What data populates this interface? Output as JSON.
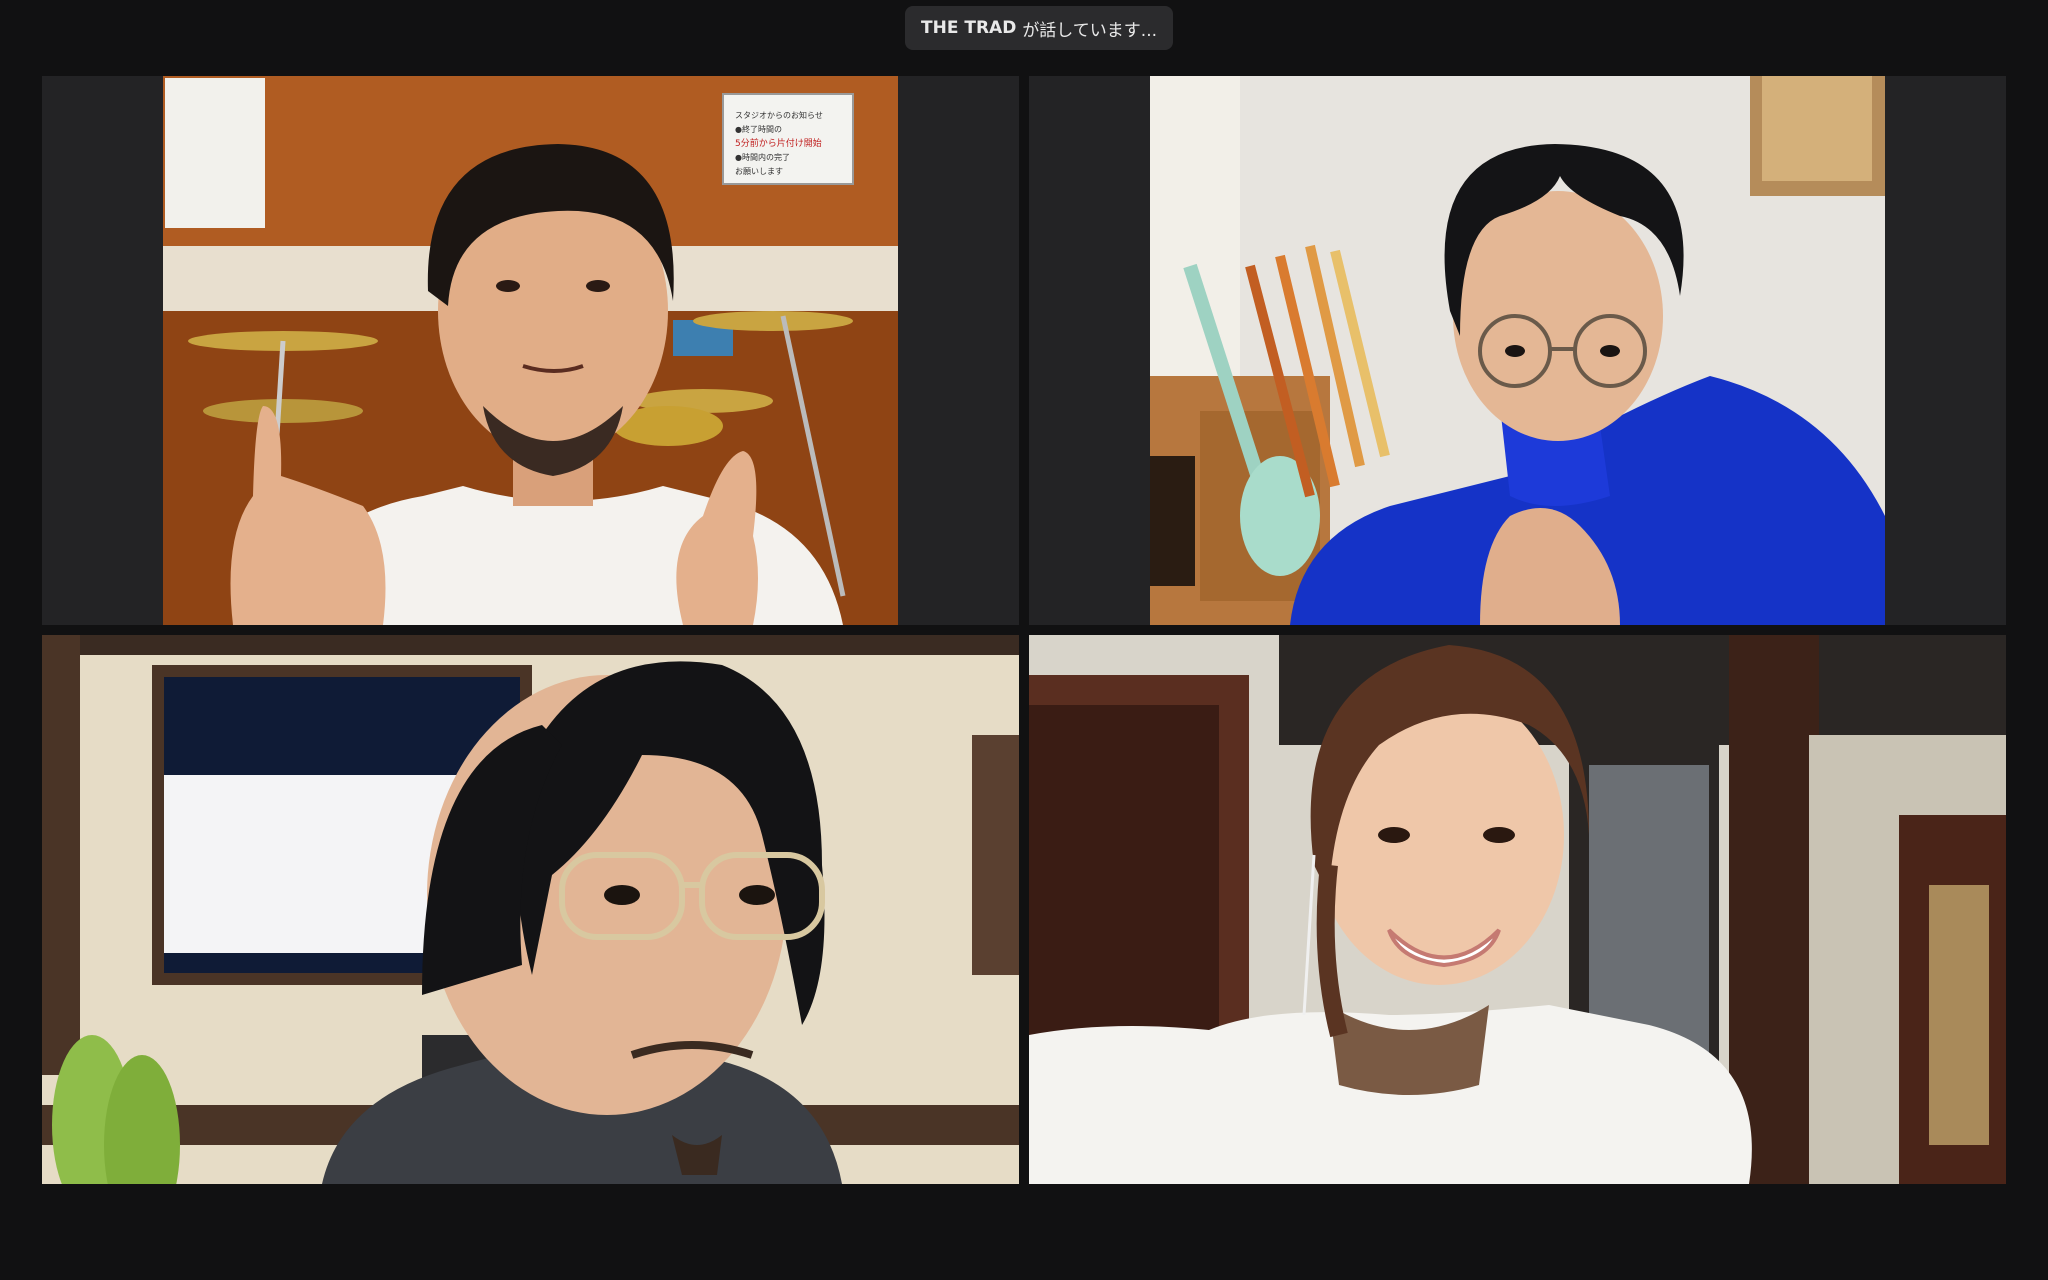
{
  "meeting": {
    "active_speaker_name": "THE TRAD",
    "active_speaker_suffix": "が話しています..."
  },
  "video_tiles": [
    {
      "position": "top-left",
      "scene": "drummer-studio"
    },
    {
      "position": "top-right",
      "scene": "guitar-room"
    },
    {
      "position": "bottom-left",
      "scene": "office-headphones"
    },
    {
      "position": "bottom-right",
      "scene": "studio-smile"
    }
  ],
  "wall_notice": {
    "line1": "スタジオからのお知らせ",
    "line2": "●終了時間の",
    "line3": "5分前から片付け開始",
    "line4": "●時間内の完了",
    "line5": "お願いします"
  },
  "colors": {
    "background": "#111112",
    "tile_bg": "#232325",
    "speaking_pill": "#2b2b2d"
  }
}
